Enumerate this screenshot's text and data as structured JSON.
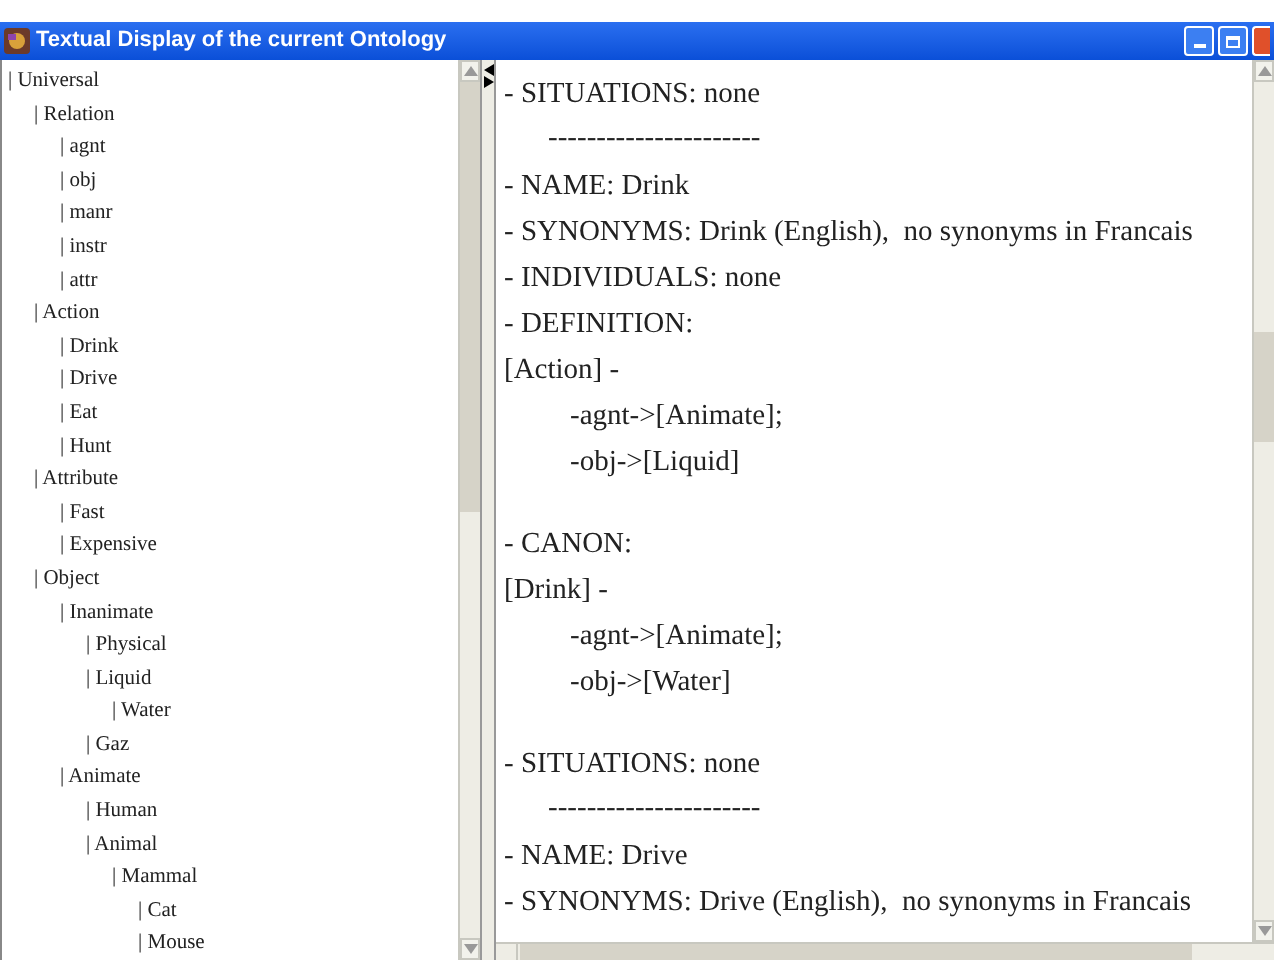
{
  "window": {
    "title": "Textual Display of the current Ontology"
  },
  "tree": [
    {
      "label": "| Universal",
      "children": [
        {
          "label": "| Relation",
          "children": [
            {
              "label": "| agnt"
            },
            {
              "label": "| obj"
            },
            {
              "label": "| manr"
            },
            {
              "label": "| instr"
            },
            {
              "label": "| attr"
            }
          ]
        },
        {
          "label": "| Action",
          "children": [
            {
              "label": "| Drink"
            },
            {
              "label": "| Drive"
            },
            {
              "label": "| Eat"
            },
            {
              "label": "| Hunt"
            }
          ]
        },
        {
          "label": "| Attribute",
          "children": [
            {
              "label": "| Fast"
            },
            {
              "label": "| Expensive"
            }
          ]
        },
        {
          "label": "| Object",
          "children": [
            {
              "label": "| Inanimate",
              "children": [
                {
                  "label": "| Physical"
                },
                {
                  "label": "| Liquid",
                  "children": [
                    {
                      "label": "| Water"
                    }
                  ]
                },
                {
                  "label": "| Gaz"
                }
              ]
            },
            {
              "label": "| Animate",
              "children": [
                {
                  "label": "| Human"
                },
                {
                  "label": "| Animal",
                  "children": [
                    {
                      "label": "| Mammal",
                      "children": [
                        {
                          "label": "| Cat"
                        },
                        {
                          "label": "| Mouse"
                        }
                      ]
                    }
                  ]
                }
              ]
            }
          ]
        }
      ]
    }
  ],
  "text_lines": [
    {
      "kind": "line",
      "text": "- SITUATIONS: none"
    },
    {
      "kind": "rule",
      "text": "----------------------"
    },
    {
      "kind": "line",
      "text": "- NAME: Drink"
    },
    {
      "kind": "line",
      "text": "- SYNONYMS: Drink (English),  no synonyms in Francais"
    },
    {
      "kind": "line",
      "text": "- INDIVIDUALS: none"
    },
    {
      "kind": "line",
      "text": "- DEFINITION:"
    },
    {
      "kind": "line",
      "text": "[Action] -"
    },
    {
      "kind": "sub",
      "text": "-agnt->[Animate];"
    },
    {
      "kind": "sub",
      "text": "-obj->[Liquid]"
    },
    {
      "kind": "gap"
    },
    {
      "kind": "line",
      "text": "- CANON:"
    },
    {
      "kind": "line",
      "text": "[Drink] -"
    },
    {
      "kind": "sub",
      "text": "-agnt->[Animate];"
    },
    {
      "kind": "sub",
      "text": "-obj->[Water]"
    },
    {
      "kind": "gap"
    },
    {
      "kind": "line",
      "text": "- SITUATIONS: none"
    },
    {
      "kind": "rule",
      "text": "----------------------"
    },
    {
      "kind": "line",
      "text": "- NAME: Drive"
    },
    {
      "kind": "line",
      "text": "- SYNONYMS: Drive (English),  no synonyms in Francais"
    }
  ]
}
